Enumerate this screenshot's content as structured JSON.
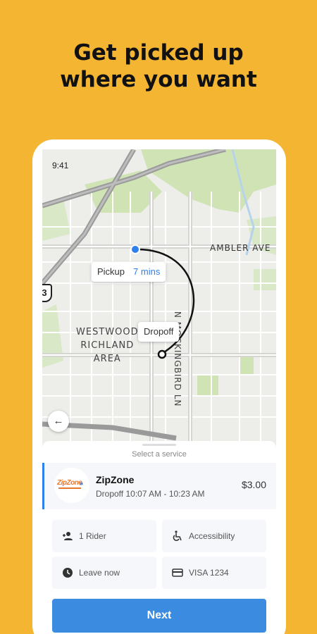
{
  "headline": "Get picked up\nwhere you want",
  "status_bar": {
    "time": "9:41"
  },
  "map": {
    "street_ambler": "AMBLER AVE",
    "area_label": "WESTWOOD\nRICHLAND\nAREA",
    "street_mockingbird": "N MOCKINGBIRD LN",
    "route_shield": "3",
    "pickup_label": "Pickup",
    "pickup_eta": "7 mins",
    "dropoff_label": "Dropoff",
    "route_color": "#111111",
    "pickup_dot_color": "#2F80ED"
  },
  "sheet": {
    "title": "Select a service",
    "service": {
      "name": "ZipZone",
      "logo_text": "ZipZone",
      "dropoff": "Dropoff 10:07 AM - 10:23 AM",
      "price": "$3.00"
    },
    "options": {
      "riders": "1 Rider",
      "accessibility": "Accessibility",
      "leave": "Leave now",
      "payment": "VISA 1234"
    },
    "next_label": "Next"
  },
  "colors": {
    "background": "#F4B532",
    "accent": "#3B8BE0"
  },
  "icons": [
    "back-arrow-icon",
    "add-person-icon",
    "wheelchair-icon",
    "clock-icon",
    "credit-card-icon"
  ]
}
